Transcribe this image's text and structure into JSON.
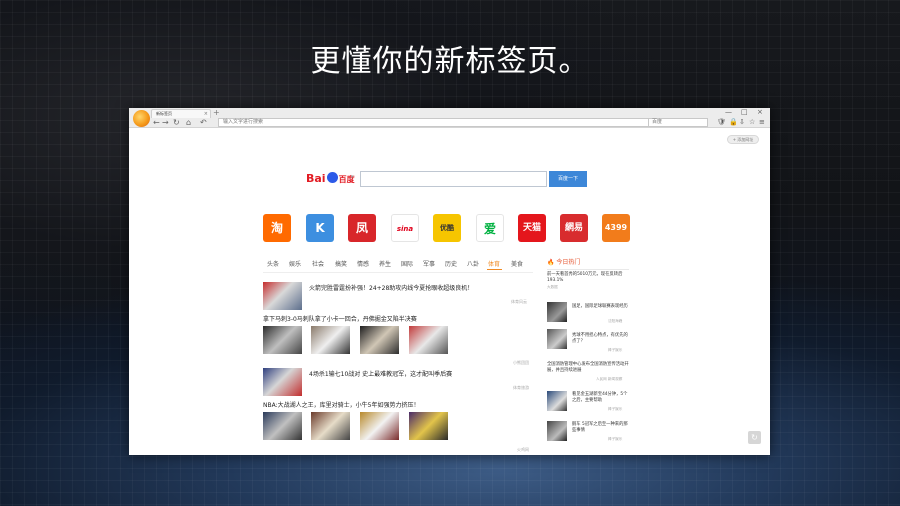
{
  "headline": "更懂你的新标签页。",
  "browser": {
    "tab_title": "新标签页",
    "tab_close": "×",
    "tab_new": "+",
    "window_controls": [
      "—",
      "□",
      "×"
    ],
    "nav": [
      "←",
      "→",
      "↻",
      "⌂",
      "↶"
    ],
    "address_placeholder": "输入文字进行搜索",
    "search_engine": "百度",
    "tool_icons": [
      "🛡",
      "🔒",
      "⇩",
      "☆",
      "≡"
    ]
  },
  "bookmark_button": "+ 添加网址",
  "baidu": {
    "logo_bai": "Bai",
    "logo_cn": "百度",
    "button": "百度一下"
  },
  "sites": [
    {
      "label": "淘",
      "color": "#ff6a00"
    },
    {
      "label": "K",
      "color": "#3d8fe0"
    },
    {
      "label": "凤",
      "color": "#d8262a"
    },
    {
      "label": "sina",
      "color": "#ffffff"
    },
    {
      "label": "优酷",
      "color": "#f6c500"
    },
    {
      "label": "爱",
      "color": "#ffffff"
    },
    {
      "label": "天猫",
      "color": "#e4161c"
    },
    {
      "label": "網易",
      "color": "#d82c2e"
    },
    {
      "label": "4399",
      "color": "#f27c1b"
    }
  ],
  "categories": [
    "头条",
    "娱乐",
    "社会",
    "搞笑",
    "情感",
    "养生",
    "国际",
    "军事",
    "历史",
    "八卦",
    "体育",
    "美食"
  ],
  "news": [
    {
      "title": "火箭完胜雷霆扮补强！24+28助攻内线今夏抢眼收超级良机！",
      "source": "体育风云"
    },
    {
      "title": "拿下马刺3-0马刺队拿了小卡一回合，丹佛掘金又陷半决赛",
      "source": "小熊团团"
    },
    {
      "title": "4场杀1输七10战对 史上最难教冠军，这才配叫季后赛",
      "source": "体育旅游"
    },
    {
      "title": "NBA:大战湖人之王，库里对骑士，小牛5年如强势力挤压！",
      "source": "火鸡网"
    }
  ],
  "hot": {
    "title": "今日热门",
    "items": [
      {
        "text": "前一天看首秀的5010万元，现在反转后193.1%",
        "meta": "大数据"
      },
      {
        "text": "国足，国际足球联赛表现经历",
        "meta": "沈阳海峰"
      },
      {
        "text": "秀球不用担心特点，有优先的点了？",
        "meta": "棒子娱乐"
      },
      {
        "text": "全国消防管理中心发布全国消防宣传活动开展，并且持续进展",
        "meta": "人民网 新闻观察"
      },
      {
        "text": "看见金五湖新宝44分钟，5个之后，主要帮助",
        "meta": "棒子娱乐"
      },
      {
        "text": "鹅车 5冠军之后至一种来的那些事情",
        "meta": "棒子娱乐"
      }
    ]
  }
}
